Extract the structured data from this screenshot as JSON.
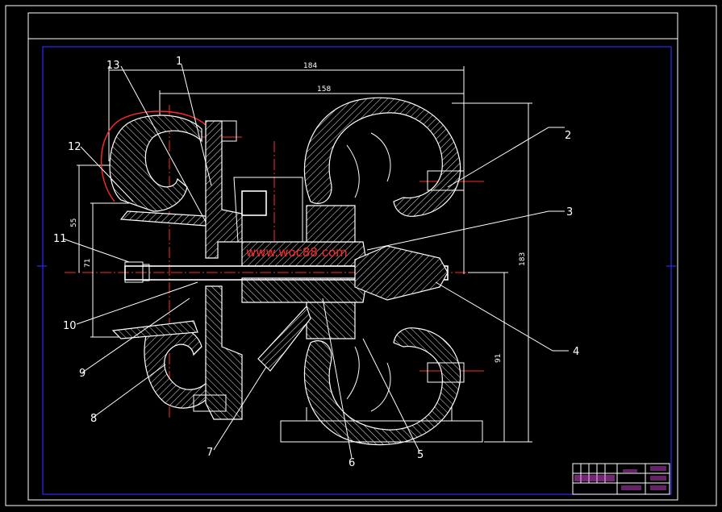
{
  "dimensions": {
    "overall_width": "184",
    "inner_width": "158",
    "overall_height": "183",
    "right_height": "91",
    "left_height_upper": "55",
    "left_height_lower": "71"
  },
  "part_labels": [
    "1",
    "2",
    "3",
    "4",
    "5",
    "6",
    "7",
    "8",
    "9",
    "10",
    "11",
    "12",
    "13"
  ],
  "watermark": "www.woc88.com",
  "colors": {
    "background": "#000000",
    "outline": "#ffffff",
    "frame": "#2a2aff",
    "centerline": "#ff2a2a",
    "title_block_text": "#ff55ff"
  }
}
